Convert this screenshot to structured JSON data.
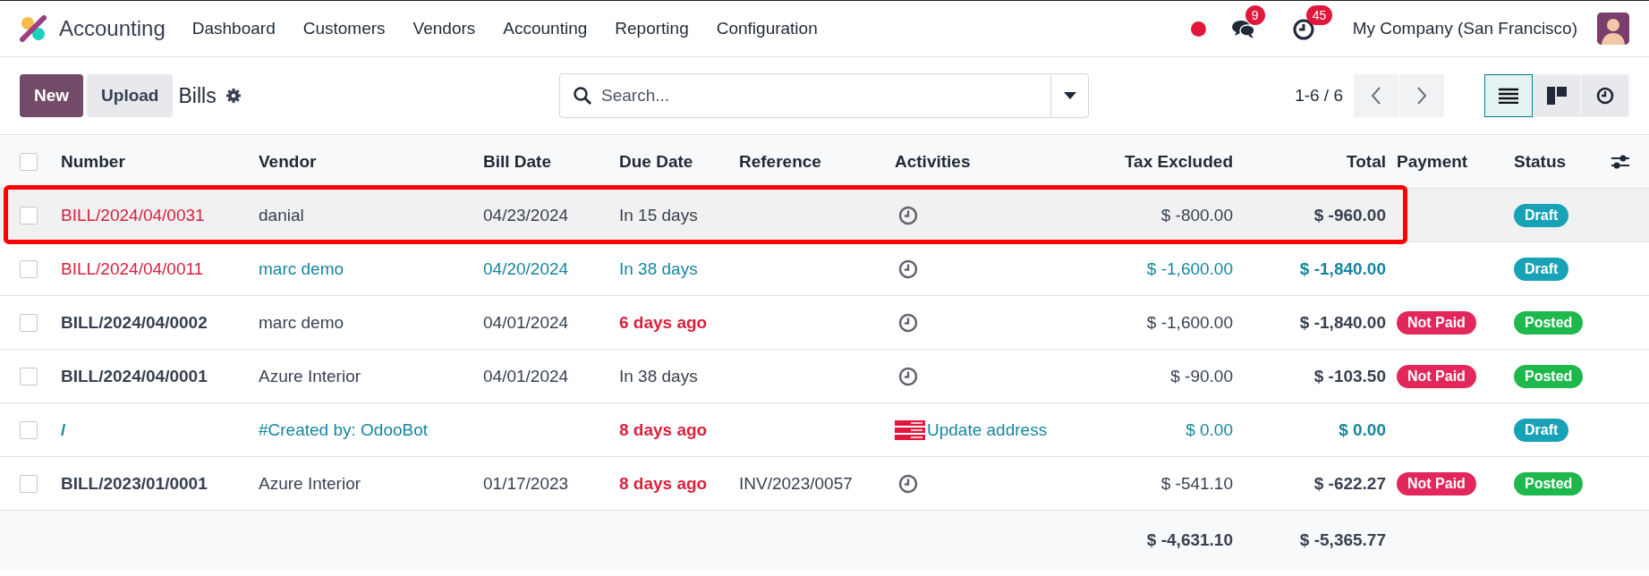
{
  "navbar": {
    "app_name": "Accounting",
    "menu": [
      "Dashboard",
      "Customers",
      "Vendors",
      "Accounting",
      "Reporting",
      "Configuration"
    ],
    "messages_count": "9",
    "activities_count": "45",
    "company": "My Company (San Francisco)"
  },
  "control_panel": {
    "new_button": "New",
    "upload_button": "Upload",
    "title": "Bills",
    "search": {
      "placeholder": "Search..."
    },
    "pager": "1-6 / 6",
    "views": [
      {
        "kind": "list",
        "selected": true
      },
      {
        "kind": "kanban",
        "selected": false
      },
      {
        "kind": "activity",
        "selected": false
      }
    ]
  },
  "table": {
    "select_all": {
      "checked": false
    },
    "columns": [
      "Number",
      "Vendor",
      "Bill Date",
      "Due Date",
      "Reference",
      "Activities",
      "Tax Excluded",
      "Total",
      "Payment",
      "Status"
    ],
    "rows": [
      {
        "checked": false,
        "hover": true,
        "annotated": true,
        "info": false,
        "number_danger": true,
        "number": "BILL/2024/04/0031",
        "vendor": "danial",
        "bill_date": "04/23/2024",
        "due_date": "In 15 days",
        "overdue": false,
        "activity": {
          "kind": "clock"
        },
        "tax_excluded": "$ -800.00",
        "total": "$ -960.00",
        "status": {
          "label": "Draft",
          "color": "#17a2b8"
        }
      },
      {
        "checked": false,
        "hover": false,
        "annotated": false,
        "info": true,
        "number_danger": true,
        "number": "BILL/2024/04/0011",
        "vendor": "marc demo",
        "bill_date": "04/20/2024",
        "due_date": "In 38 days",
        "overdue": false,
        "activity": {
          "kind": "clock"
        },
        "tax_excluded": "$ -1,600.00",
        "total": "$ -1,840.00",
        "status": {
          "label": "Draft",
          "color": "#17a2b8"
        }
      },
      {
        "checked": false,
        "hover": false,
        "annotated": false,
        "info": false,
        "number_danger": false,
        "number": "BILL/2024/04/0002",
        "vendor": "marc demo",
        "bill_date": "04/01/2024",
        "due_date": "6 days ago",
        "overdue": true,
        "activity": {
          "kind": "clock"
        },
        "tax_excluded": "$ -1,600.00",
        "total": "$ -1,840.00",
        "payment": {
          "label": "Not Paid",
          "color": "#e2275a"
        },
        "status": {
          "label": "Posted",
          "color": "#1fb84c"
        }
      },
      {
        "checked": false,
        "hover": false,
        "annotated": false,
        "info": false,
        "number_danger": false,
        "number": "BILL/2024/04/0001",
        "vendor": "Azure Interior",
        "bill_date": "04/01/2024",
        "due_date": "In 38 days",
        "overdue": false,
        "activity": {
          "kind": "clock"
        },
        "tax_excluded": "$ -90.00",
        "total": "$ -103.50",
        "payment": {
          "label": "Not Paid",
          "color": "#e2275a"
        },
        "status": {
          "label": "Posted",
          "color": "#1fb84c"
        }
      },
      {
        "checked": false,
        "hover": false,
        "annotated": false,
        "info": true,
        "number_danger": false,
        "number": "/",
        "vendor": "#Created by: OdooBot",
        "due_date": "8 days ago",
        "overdue": true,
        "activity": {
          "kind": "mail_error",
          "label": "Update address"
        },
        "tax_excluded": "$ 0.00",
        "total": "$ 0.00",
        "status": {
          "label": "Draft",
          "color": "#17a2b8"
        }
      },
      {
        "checked": false,
        "hover": false,
        "annotated": false,
        "info": false,
        "number_danger": false,
        "number": "BILL/2023/01/0001",
        "vendor": "Azure Interior",
        "bill_date": "01/17/2023",
        "due_date": "8 days ago",
        "overdue": true,
        "reference": "INV/2023/0057",
        "activity": {
          "kind": "clock"
        },
        "tax_excluded": "$ -541.10",
        "total": "$ -622.27",
        "payment": {
          "label": "Not Paid",
          "color": "#e2275a"
        },
        "status": {
          "label": "Posted",
          "color": "#1fb84c"
        }
      }
    ],
    "totals": {
      "tax_excluded": "$ -4,631.10",
      "total": "$ -5,365.77"
    }
  }
}
